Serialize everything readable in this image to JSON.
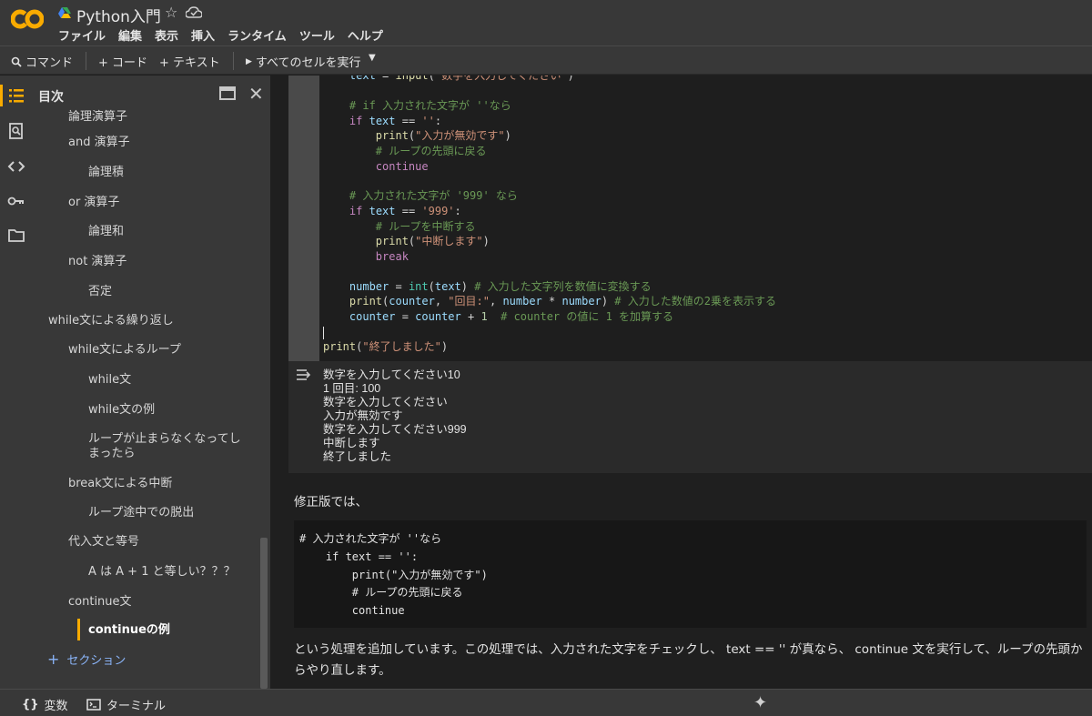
{
  "header": {
    "title": "Python入門",
    "menu": [
      "ファイル",
      "編集",
      "表示",
      "挿入",
      "ランタイム",
      "ツール",
      "ヘルプ"
    ]
  },
  "toolbar": {
    "command": "コマンド",
    "add_code": "+ コード",
    "add_text": "+ テキスト",
    "run_all": "すべてのセルを実行"
  },
  "toc": {
    "title": "目次",
    "items": [
      {
        "label": "論理演算子",
        "level": 2
      },
      {
        "label": "and 演算子",
        "level": 2
      },
      {
        "label": "論理積",
        "level": 3
      },
      {
        "label": "or 演算子",
        "level": 2
      },
      {
        "label": "論理和",
        "level": 3
      },
      {
        "label": "not 演算子",
        "level": 2
      },
      {
        "label": "否定",
        "level": 3
      },
      {
        "label": "while文による繰り返し",
        "level": 1
      },
      {
        "label": "while文によるループ",
        "level": 2
      },
      {
        "label": "while文",
        "level": 3
      },
      {
        "label": "while文の例",
        "level": 3
      },
      {
        "label": "ループが止まらなくなってしまったら",
        "level": 3
      },
      {
        "label": "break文による中断",
        "level": 2
      },
      {
        "label": "ループ途中での脱出",
        "level": 3
      },
      {
        "label": "代入文と等号",
        "level": 2
      },
      {
        "label": "A は A + 1 と等しい？？？",
        "level": 3
      },
      {
        "label": "continue文",
        "level": 2
      },
      {
        "label": "continueの例",
        "level": 3,
        "active": true
      }
    ],
    "add_section": "セクション"
  },
  "code_cell": {
    "lines": [
      "    text = input('数字を入力してください')",
      "",
      "    # if 入力された文字が ''なら",
      "    if text == '':",
      "        print(\"入力が無効です\")",
      "        # ループの先頭に戻る",
      "        continue",
      "",
      "    # 入力された文字が '999' なら",
      "    if text == '999':",
      "        # ループを中断する",
      "        print(\"中断します\")",
      "        break",
      "",
      "    number = int(text) # 入力した文字列を数値に変換する",
      "    print(counter, \"回目:\", number * number) # 入力した数値の2乗を表示する",
      "    counter = counter + 1  # counter の値に 1 を加算する",
      "",
      "print(\"終了しました\")"
    ]
  },
  "output": {
    "lines": [
      "数字を入力してください10",
      "1 回目: 100",
      "数字を入力してください",
      "入力が無効です",
      "数字を入力してください999",
      "中断します",
      "終了しました"
    ]
  },
  "markdown": {
    "p1": "修正版では、",
    "code_block": [
      "# 入力された文字が ''なら",
      "    if text == '':",
      "        print(\"入力が無効です\")",
      "        # ループの先頭に戻る",
      "        continue"
    ],
    "p2": "という処理を追加しています。この処理では、入力された文字をチェックし、 text == '' が真なら、 continue 文を実行して、ループの先頭からやり直します。"
  },
  "bottombar": {
    "variables": "変数",
    "terminal": "ターミナル"
  },
  "colors": {
    "accent": "#f9ab00",
    "link": "#8ab4f8",
    "background": "#1f1f1f",
    "panel": "#383838"
  }
}
